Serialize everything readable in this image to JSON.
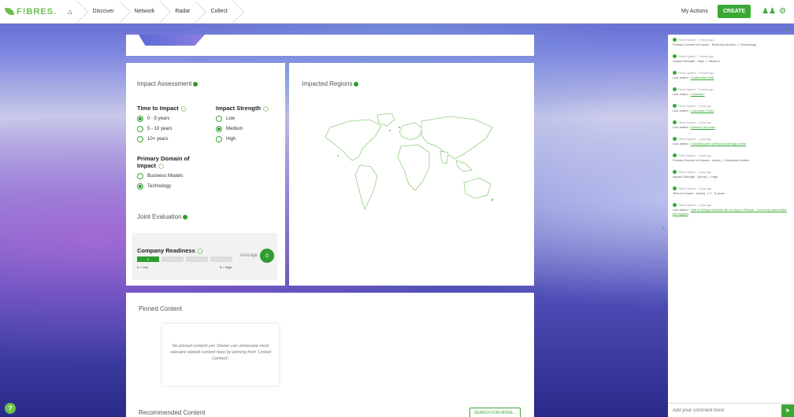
{
  "brand": {
    "name": "F!BRES."
  },
  "nav": {
    "crumbs": [
      "Discover",
      "Network",
      "Radar",
      "Collect"
    ]
  },
  "top": {
    "my_actions": "My Actions",
    "create": "CREATE"
  },
  "impact": {
    "title": "Impact Assessment",
    "time_title": "Time to Impact",
    "time_options": [
      "0 - 5 years",
      "5 - 10 years",
      "10+ years"
    ],
    "strength_title": "Impact Strength",
    "strength_options": [
      "Low",
      "Medium",
      "High"
    ],
    "domain_title_1": "Primary Domain of",
    "domain_title_2": "Impact",
    "domain_options": [
      "Business Models",
      "Technology"
    ]
  },
  "joint": {
    "title": "Joint Evaluation",
    "readiness_title": "Company Readiness",
    "scale": [
      "0",
      "1",
      "2",
      "3"
    ],
    "low": "0 = Low",
    "high": "3 = High",
    "average_label": "Average",
    "average_value": "0"
  },
  "regions": {
    "title": "Impacted Regions"
  },
  "pinned": {
    "title": "Pinned Content",
    "empty": "No pinned content yet. Owner can showcase most relevant related content here by pinning from 'Linked Content'."
  },
  "recommended": {
    "title": "Recommended Content",
    "search": "SEARCH FOR MORE..."
  },
  "activity": [
    {
      "who": "Fibres System · 3 weeks ago",
      "text": "Primary Domain of Impact : Business Models -> Technology",
      "link": ""
    },
    {
      "who": "Fibres System · 3 weeks ago",
      "text": "Impact Strength : High -> Medium",
      "link": ""
    },
    {
      "who": "Fibres System · 3 weeks ago",
      "text": "Link added : ",
      "link": "Continental Shift"
    },
    {
      "who": "Fibres System · 3 weeks ago",
      "text": "Link added : ",
      "link": "Collection"
    },
    {
      "who": "Fibres System · 1 year ago",
      "text": "Link added : ",
      "link": "Corporate Crime"
    },
    {
      "who": "Fibres System · 1 year ago",
      "text": "Link added : ",
      "link": "Delivery Services"
    },
    {
      "who": "Fibres System · 1 year ago",
      "text": "Link added : ",
      "link": "Compiling and selling knowledge online"
    },
    {
      "who": "Fibres System · 1 year ago",
      "text": "Primary Domain of Impact : (none) -> Business Models",
      "link": ""
    },
    {
      "who": "Fibres System · 1 year ago",
      "text": "Impact Strength : (none) -> High",
      "link": ""
    },
    {
      "who": "Fibres System · 1 year ago",
      "text": "Time to Impact : (none) -> 0 - 5 years",
      "link": ""
    },
    {
      "who": "Fibres System · 1 year ago",
      "text": "Link added : ",
      "link": "Half of foreign students aim to stay in Finland – but many want better job support"
    }
  ],
  "comment": {
    "placeholder": "Add your comment here!"
  },
  "help": "?",
  "colors": {
    "accent": "#3aa835",
    "brand": "#6cc04a"
  }
}
